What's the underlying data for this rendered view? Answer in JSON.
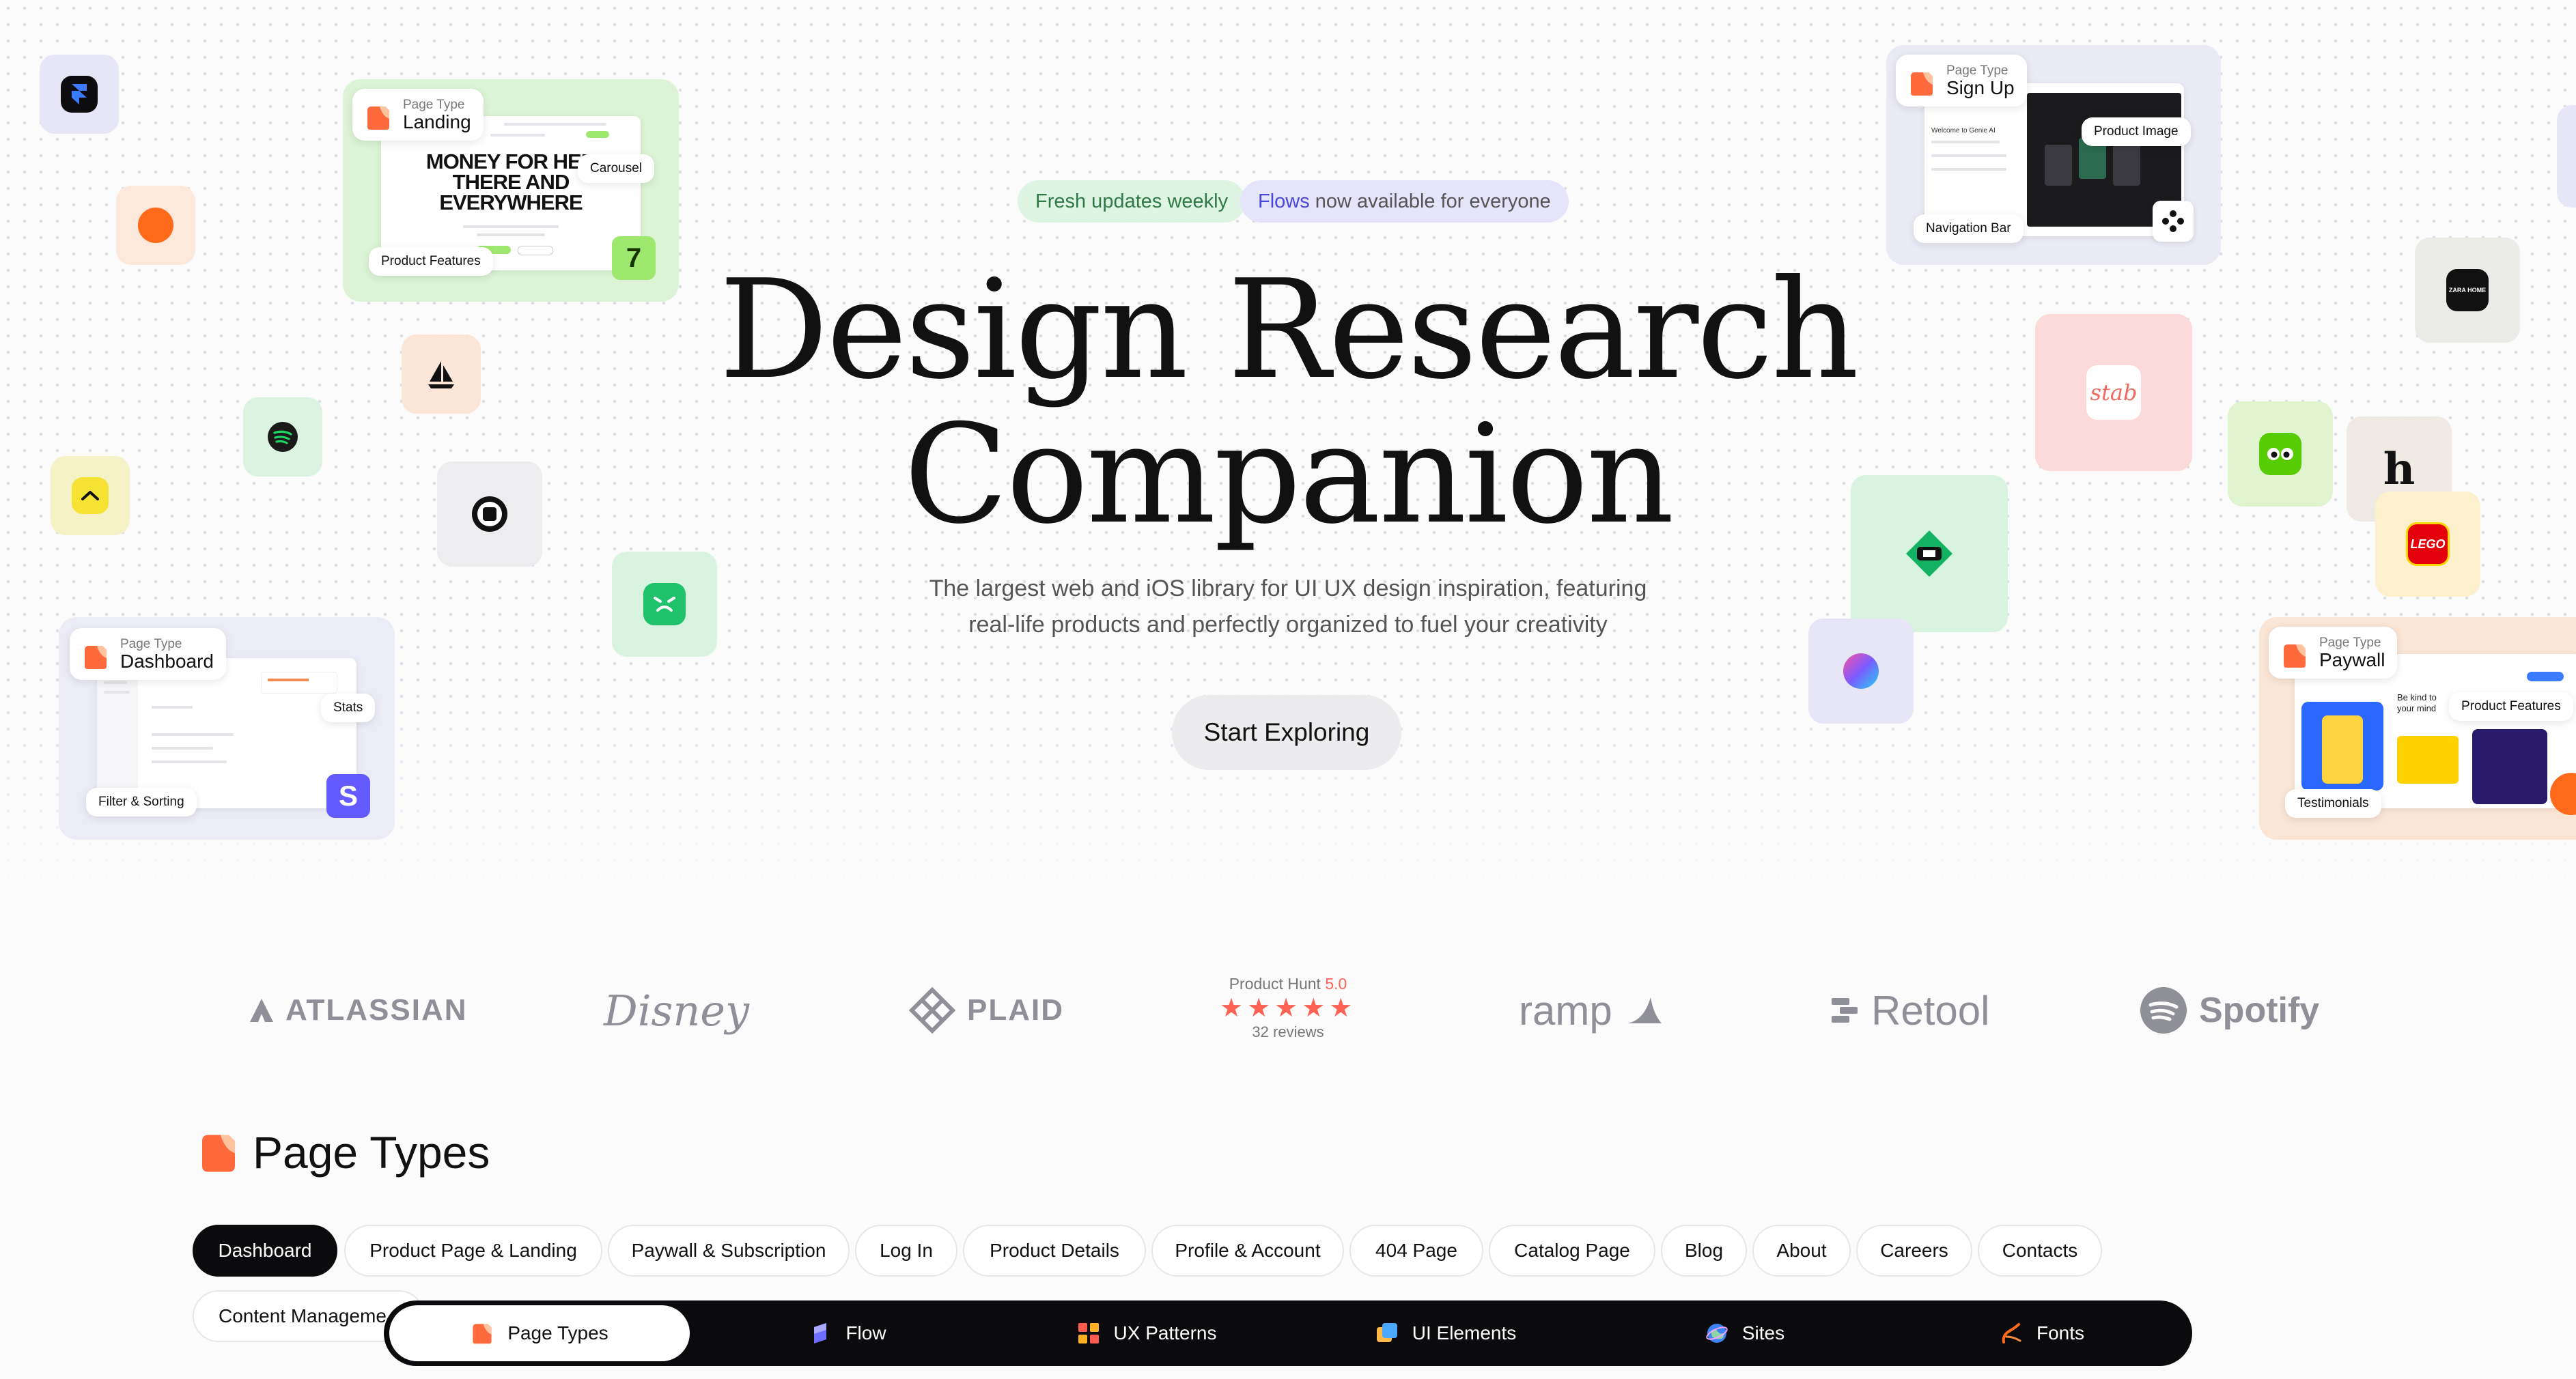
{
  "badges": {
    "fresh": "Fresh updates weekly",
    "flows_word": "Flows",
    "flows_rest": "now available for everyone"
  },
  "hero": {
    "title_line1": "Design Research",
    "title_line2": "Companion",
    "subtitle_line1": "The largest web and iOS library for UI UX design inspiration, featuring",
    "subtitle_line2": "real-life products and perfectly organized to fuel your creativity",
    "cta": "Start Exploring"
  },
  "cards": {
    "landing": {
      "caption": "Page Type",
      "value": "Landing",
      "headline_1": "MONEY FOR HER",
      "headline_2": "THERE AND",
      "headline_3": "EVERYWHERE",
      "chip_carousel": "Carousel",
      "chip_features": "Product Features",
      "app_letter": "7"
    },
    "signup": {
      "caption": "Page Type",
      "value": "Sign Up",
      "chip_image": "Product Image",
      "chip_nav": "Navigation Bar",
      "welcome": "Welcome to Genie AI"
    },
    "dashboard": {
      "caption": "Page Type",
      "value": "Dashboard",
      "chip_stats": "Stats",
      "chip_filter": "Filter & Sorting",
      "app_letter": "S"
    },
    "paywall": {
      "caption": "Page Type",
      "value": "Paywall",
      "chip_features": "Product Features",
      "chip_testimonials": "Testimonials",
      "kind": "Be kind to your mind"
    }
  },
  "tiles": {
    "stab_text": "stab",
    "h_text": "h",
    "lego_text": "LEGO",
    "zara_text": "ZARA HOME"
  },
  "logos": {
    "atlassian": "ATLASSIAN",
    "disney": "Disney",
    "plaid": "PLAID",
    "ph_label": "Product Hunt",
    "ph_score": "5.0",
    "ph_stars": "★★★★★",
    "ph_reviews": "32 reviews",
    "ramp": "ramp",
    "retool": "Retool",
    "spotify": "Spotify"
  },
  "section": {
    "title": "Page Types",
    "pills": [
      "Dashboard",
      "Product Page & Landing",
      "Paywall & Subscription",
      "Log In",
      "Product Details",
      "Profile & Account",
      "404 Page",
      "Catalog Page",
      "Blog",
      "About",
      "Careers",
      "Contacts",
      "Content Manageme"
    ]
  },
  "nav": {
    "items": [
      "Page Types",
      "Flow",
      "UX Patterns",
      "UI Elements",
      "Sites",
      "Fonts"
    ]
  },
  "colors": {
    "accent_orange": "#ff6a1a",
    "green_badge": "#dff5e3",
    "purple_badge": "#e6e4fb",
    "purple_text": "#4a48d8"
  }
}
